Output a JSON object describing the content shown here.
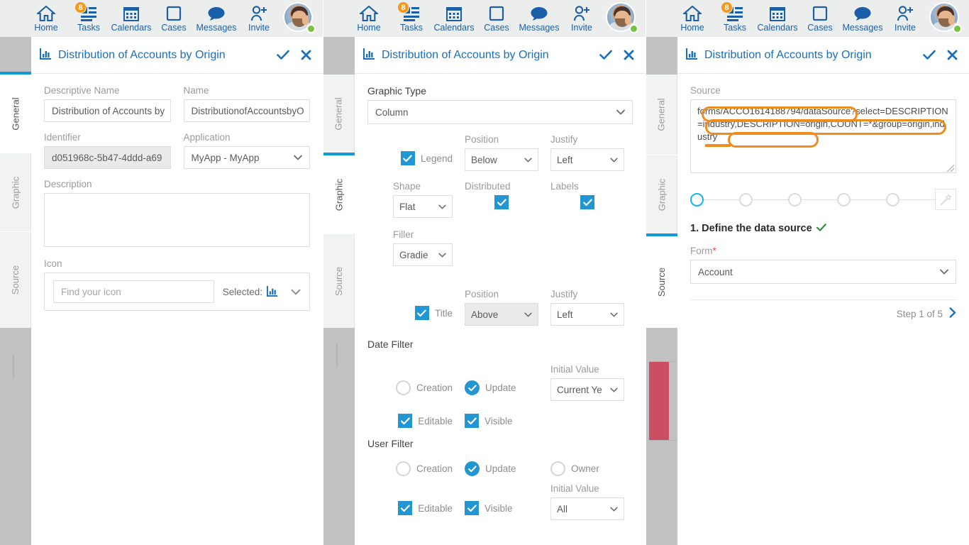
{
  "topnav": {
    "items": [
      {
        "label": "Home",
        "icon": "home-icon",
        "badge": null
      },
      {
        "label": "Tasks",
        "icon": "tasks-icon",
        "badge": "8"
      },
      {
        "label": "Calendars",
        "icon": "calendar-icon",
        "badge": null
      },
      {
        "label": "Cases",
        "icon": "cases-icon",
        "badge": null
      },
      {
        "label": "Messages",
        "icon": "messages-icon",
        "badge": null
      },
      {
        "label": "Invite",
        "icon": "invite-icon",
        "badge": null
      }
    ],
    "badge_color": "#f29a1d",
    "accent_color": "#1b5fa8",
    "status_color": "#7ac143"
  },
  "dialog": {
    "title": "Distribution of Accounts by Origin",
    "title_icon": "bar-chart-icon",
    "confirm_icon": "check-icon",
    "close_icon": "close-icon",
    "accent_color": "#1b6fbb"
  },
  "tabs": {
    "general": "General",
    "graphic": "Graphic",
    "source": "Source",
    "active_color": "#0f9bd7"
  },
  "panel_left": {
    "active_tab": "General",
    "descriptive_name": {
      "label": "Descriptive Name",
      "value": "Distribution of Accounts by"
    },
    "name": {
      "label": "Name",
      "value": "DistributionofAccountsbyO"
    },
    "identifier": {
      "label": "Identifier",
      "value": "d051968c-5b47-4ddd-a69"
    },
    "application": {
      "label": "Application",
      "value": "MyApp - MyApp"
    },
    "description": {
      "label": "Description",
      "value": ""
    },
    "icon": {
      "label": "Icon",
      "placeholder": "Find your icon",
      "selected_label": "Selected:",
      "selected_icon": "bar-chart-icon"
    }
  },
  "panel_mid": {
    "active_tab": "Graphic",
    "graphic_type": {
      "label": "Graphic Type",
      "value": "Column"
    },
    "legend": {
      "checkbox_label": "Legend",
      "checked": true,
      "position_label": "Position",
      "position_value": "Below",
      "justify_label": "Justify",
      "justify_value": "Left"
    },
    "shape": {
      "label": "Shape",
      "value": "Flat"
    },
    "distributed": {
      "label": "Distributed",
      "checked": true
    },
    "labels": {
      "label": "Labels",
      "checked": true
    },
    "filler": {
      "label": "Filler",
      "value": "Gradie"
    },
    "title": {
      "checkbox_label": "Title",
      "checked": true,
      "position_label": "Position",
      "position_value": "Above",
      "position_disabled": true,
      "justify_label": "Justify",
      "justify_value": "Left"
    },
    "date_filter": {
      "heading": "Date Filter",
      "creation": {
        "label": "Creation",
        "selected": false
      },
      "update": {
        "label": "Update",
        "selected": true
      },
      "initial_value_label": "Initial Value",
      "initial_value": "Current Ye",
      "editable": {
        "label": "Editable",
        "checked": true
      },
      "visible": {
        "label": "Visible",
        "checked": true
      }
    },
    "user_filter": {
      "heading": "User Filter",
      "creation": {
        "label": "Creation",
        "selected": false
      },
      "update": {
        "label": "Update",
        "selected": true
      },
      "owner": {
        "label": "Owner",
        "selected": false
      },
      "initial_value_label": "Initial Value",
      "initial_value": "All",
      "editable": {
        "label": "Editable",
        "checked": true
      },
      "visible": {
        "label": "Visible",
        "checked": true
      }
    }
  },
  "panel_right": {
    "active_tab": "Source",
    "source": {
      "label": "Source",
      "value": "forms/ACCO1614188794/dataSource?select=DESCRIPTION=industry,DESCRIPTION=origin,COUNT=*&group=origin,industry",
      "segments": {
        "endpoint": "forms/ACCO1614188794/dataSource?",
        "select": "select=DESCRIPTION=industry,DESCRIPTION=origin,COUNT=*&",
        "group": "group=origin,industry"
      },
      "highlight_color": "#f08c1c"
    },
    "stepper": {
      "total": 5,
      "active_index": 0,
      "wand_icon": "magic-wand-icon"
    },
    "step_title": "1. Define the data source",
    "step_done_icon": "check-icon",
    "form": {
      "label": "Form",
      "required": "*",
      "value": "Account"
    },
    "step_nav": {
      "text": "Step 1 of 5",
      "next_icon": "chevron-right-icon"
    }
  }
}
